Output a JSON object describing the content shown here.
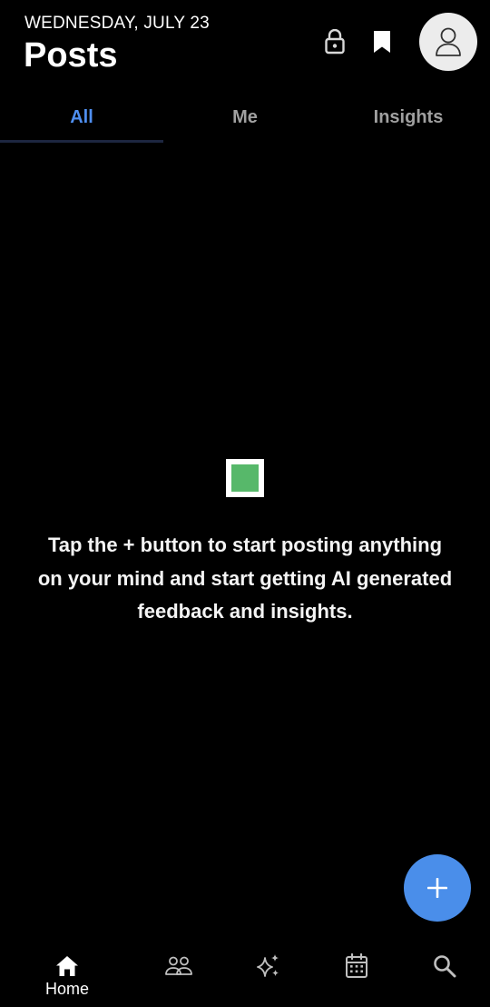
{
  "header": {
    "date": "WEDNESDAY, JULY 23",
    "title": "Posts",
    "icons": [
      "lock-icon",
      "bookmark-icon",
      "profile-icon"
    ]
  },
  "tabs": [
    {
      "label": "All",
      "active": true
    },
    {
      "label": "Me",
      "active": false
    },
    {
      "label": "Insights",
      "active": false
    }
  ],
  "empty_state": {
    "icon": "green-square-icon",
    "message": "Tap the + button to start posting anything on your mind and start getting AI generated feedback and insights."
  },
  "fab": {
    "icon": "plus-icon"
  },
  "bottom_nav": [
    {
      "icon": "home-icon",
      "label": "Home",
      "active": true
    },
    {
      "icon": "people-icon",
      "label": ""
    },
    {
      "icon": "sparkle-icon",
      "label": ""
    },
    {
      "icon": "calendar-icon",
      "label": ""
    },
    {
      "icon": "search-icon",
      "label": ""
    }
  ],
  "colors": {
    "background": "#000000",
    "accent": "#4f8ff0",
    "fab": "#4a8eea",
    "empty_icon": "#57b86a",
    "inactive_tab": "#a0a0a0"
  }
}
